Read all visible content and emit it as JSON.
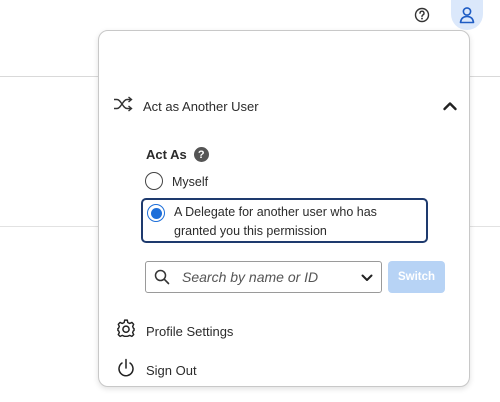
{
  "header": {
    "help_icon": "help-circle-icon",
    "user_icon": "user-icon"
  },
  "panel": {
    "act_as_section": {
      "title": "Act as Another User",
      "icon": "shuffle-icon",
      "expanded": true,
      "act_as_label": "Act As",
      "options": [
        {
          "label": "Myself",
          "selected": false
        },
        {
          "label_line1": "A Delegate for another user who has",
          "label_line2": "granted you this permission",
          "selected": true
        }
      ],
      "search": {
        "placeholder": "Search by name or ID",
        "value": ""
      },
      "switch_label": "Switch"
    },
    "menu": {
      "profile_settings": "Profile Settings",
      "sign_out": "Sign Out"
    }
  },
  "colors": {
    "accent": "#1e6fd9",
    "selected_border": "#1e3a6e",
    "switch_disabled": "#b7d3f5",
    "user_badge": "#dbe8fb"
  }
}
